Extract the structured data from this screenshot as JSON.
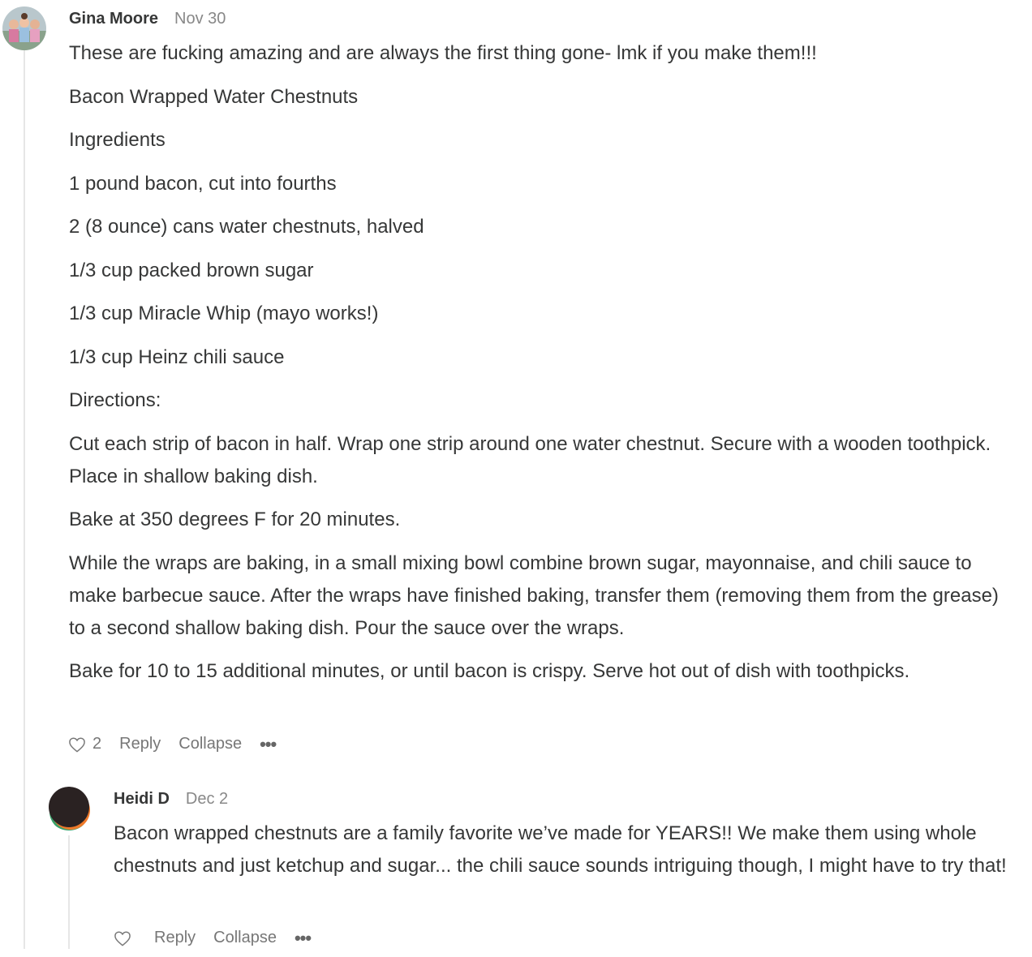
{
  "comments": [
    {
      "author": "Gina Moore",
      "date": "Nov 30",
      "paragraphs": [
        "These are fucking amazing and are always the first thing gone- lmk if you make them!!!",
        "Bacon Wrapped Water Chestnuts",
        "Ingredients",
        "1 pound bacon, cut into fourths",
        "2 (8 ounce) cans water chestnuts, halved",
        "1/3 cup packed brown sugar",
        "1/3 cup Miracle Whip (mayo works!)",
        "1/3 cup Heinz chili sauce",
        "Directions:",
        "Cut each strip of bacon in half. Wrap one strip around one water chestnut. Secure with a wooden toothpick. Place in shallow baking dish.",
        "Bake at 350 degrees F for 20 minutes.",
        "While the wraps are baking, in a small mixing bowl combine brown sugar, mayonnaise, and chili sauce to make barbecue sauce. After the wraps have finished baking, transfer them (removing them from the grease) to a second shallow baking dish. Pour the sauce over the wraps.",
        "Bake for 10 to 15 additional minutes, or until bacon is crispy. Serve hot out of dish with toothpicks."
      ],
      "like_count": "2",
      "reply_label": "Reply",
      "collapse_label": "Collapse",
      "more_label": "•••"
    },
    {
      "author": "Heidi D",
      "date": "Dec 2",
      "paragraphs": [
        "Bacon wrapped chestnuts are a family favorite we’ve made for YEARS!! We make them using whole chestnuts and just ketchup and sugar... the chili sauce sounds intriguing though, I might have to try that!"
      ],
      "like_count": "",
      "reply_label": "Reply",
      "collapse_label": "Collapse",
      "more_label": "•••"
    }
  ],
  "icons": {
    "like": "heart-icon",
    "more": "ellipsis-icon"
  },
  "colors": {
    "text": "#363737",
    "muted": "#777777",
    "thread_line": "#e6e6e6"
  }
}
